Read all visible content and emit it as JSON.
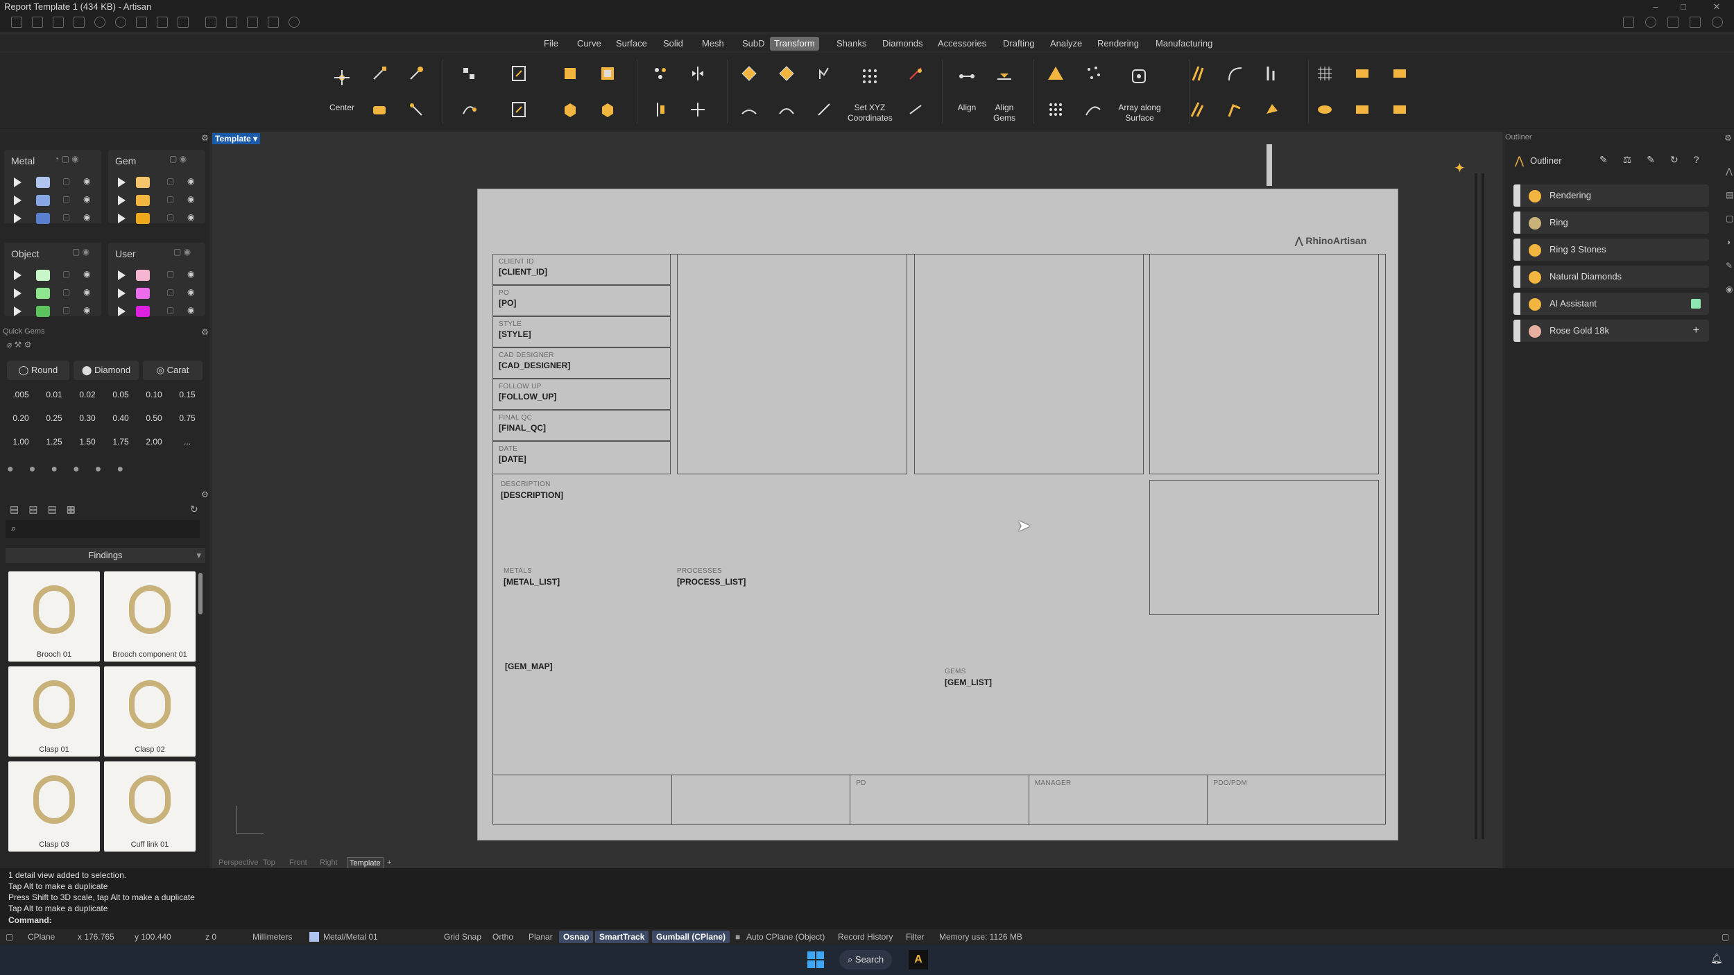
{
  "window": {
    "title": "Report Template 1 (434 KB) - Artisan"
  },
  "menu": [
    "File",
    "Curve",
    "Surface",
    "Solid",
    "Mesh",
    "SubD",
    "Transform",
    "Shanks",
    "Diamonds",
    "Accessories",
    "Drafting",
    "Analyze",
    "Rendering",
    "Manufacturing"
  ],
  "menu_active": "Transform",
  "toolbar": {
    "center": "Center",
    "set_xyz": "Set XYZ\nCoordinates",
    "align": "Align",
    "align_gems": "Align\nGems",
    "array_surface": "Array along\nSurface"
  },
  "layers": {
    "metal": {
      "title": "Metal",
      "colors": [
        "#b0c4f0",
        "#86a6e4",
        "#5b7fcf"
      ]
    },
    "gem": {
      "title": "Gem",
      "colors": [
        "#f6c46a",
        "#f2b640",
        "#eea81c"
      ]
    },
    "object": {
      "title": "Object",
      "colors": [
        "#c8f6c8",
        "#8ee68e",
        "#5cc45c"
      ]
    },
    "user": {
      "title": "User",
      "colors": [
        "#f6b6d2",
        "#ec6cec",
        "#e020e0"
      ]
    }
  },
  "quick_gems": {
    "title": "Quick Gems",
    "shape": "Round",
    "material": "Diamond",
    "unit": "Carat",
    "sizes": [
      ".005",
      "0.01",
      "0.02",
      "0.05",
      "0.10",
      "0.15",
      "0.20",
      "0.25",
      "0.30",
      "0.40",
      "0.50",
      "0.75",
      "1.00",
      "1.25",
      "1.50",
      "1.75",
      "2.00",
      "..."
    ]
  },
  "library": {
    "category": "Findings",
    "items": [
      "Brooch 01",
      "Brooch component 01",
      "Clasp 01",
      "Clasp 02",
      "Clasp 03",
      "Cuff link 01"
    ]
  },
  "viewport": {
    "tab": "Template",
    "tabs": [
      "Perspective",
      "Top",
      "Front",
      "Right",
      "Template"
    ],
    "add": "+"
  },
  "sheet": {
    "brand": "RhinoArtisan",
    "fields": [
      {
        "label": "CLIENT ID",
        "value": "[CLIENT_ID]"
      },
      {
        "label": "PO",
        "value": "[PO]"
      },
      {
        "label": "STYLE",
        "value": "[STYLE]"
      },
      {
        "label": "CAD DESIGNER",
        "value": "[CAD_DESIGNER]"
      },
      {
        "label": "FOLLOW UP",
        "value": "[FOLLOW_UP]"
      },
      {
        "label": "FINAL QC",
        "value": "[FINAL_QC]"
      },
      {
        "label": "DATE",
        "value": "[DATE]"
      }
    ],
    "description": {
      "label": "DESCRIPTION",
      "value": "[DESCRIPTION]"
    },
    "metals": {
      "label": "METALS",
      "value": "[METAL_LIST]"
    },
    "processes": {
      "label": "PROCESSES",
      "value": "[PROCESS_LIST]"
    },
    "gem_map": "[GEM_MAP]",
    "gems": {
      "label": "GEMS",
      "value": "[GEM_LIST]"
    },
    "footer": [
      "",
      "",
      "PD",
      "MANAGER",
      "PDO/PDM"
    ]
  },
  "outliner": {
    "title": "Outliner",
    "items": [
      {
        "label": "Rendering",
        "icon": "palette-icon"
      },
      {
        "label": "Ring",
        "icon": "ring-icon"
      },
      {
        "label": "Ring 3 Stones",
        "icon": "stones-icon"
      },
      {
        "label": "Natural Diamonds",
        "icon": "diamond-icon"
      },
      {
        "label": "AI Assistant",
        "icon": "robot-icon"
      },
      {
        "label": "Rose Gold 18k",
        "icon": "material-ball-icon"
      }
    ]
  },
  "command_history": [
    "1 detail view added to selection.",
    "Tap Alt to make a duplicate",
    "Press Shift to 3D scale, tap Alt to make a duplicate",
    "Tap Alt to make a duplicate"
  ],
  "command_prompt": "Command:",
  "status": {
    "cplane": "CPlane",
    "x": "x 176.765",
    "y": "y 100.440",
    "z": "z 0",
    "units": "Millimeters",
    "layer": "Metal/Metal 01",
    "grid_snap": "Grid Snap",
    "ortho": "Ortho",
    "planar": "Planar",
    "osnap": "Osnap",
    "smarttrack": "SmartTrack",
    "gumball": "Gumball (CPlane)",
    "auto_cplane": "Auto CPlane (Object)",
    "record_history": "Record History",
    "filter": "Filter",
    "memory": "Memory use: 1126 MB"
  },
  "taskbar": {
    "search": "Search"
  }
}
